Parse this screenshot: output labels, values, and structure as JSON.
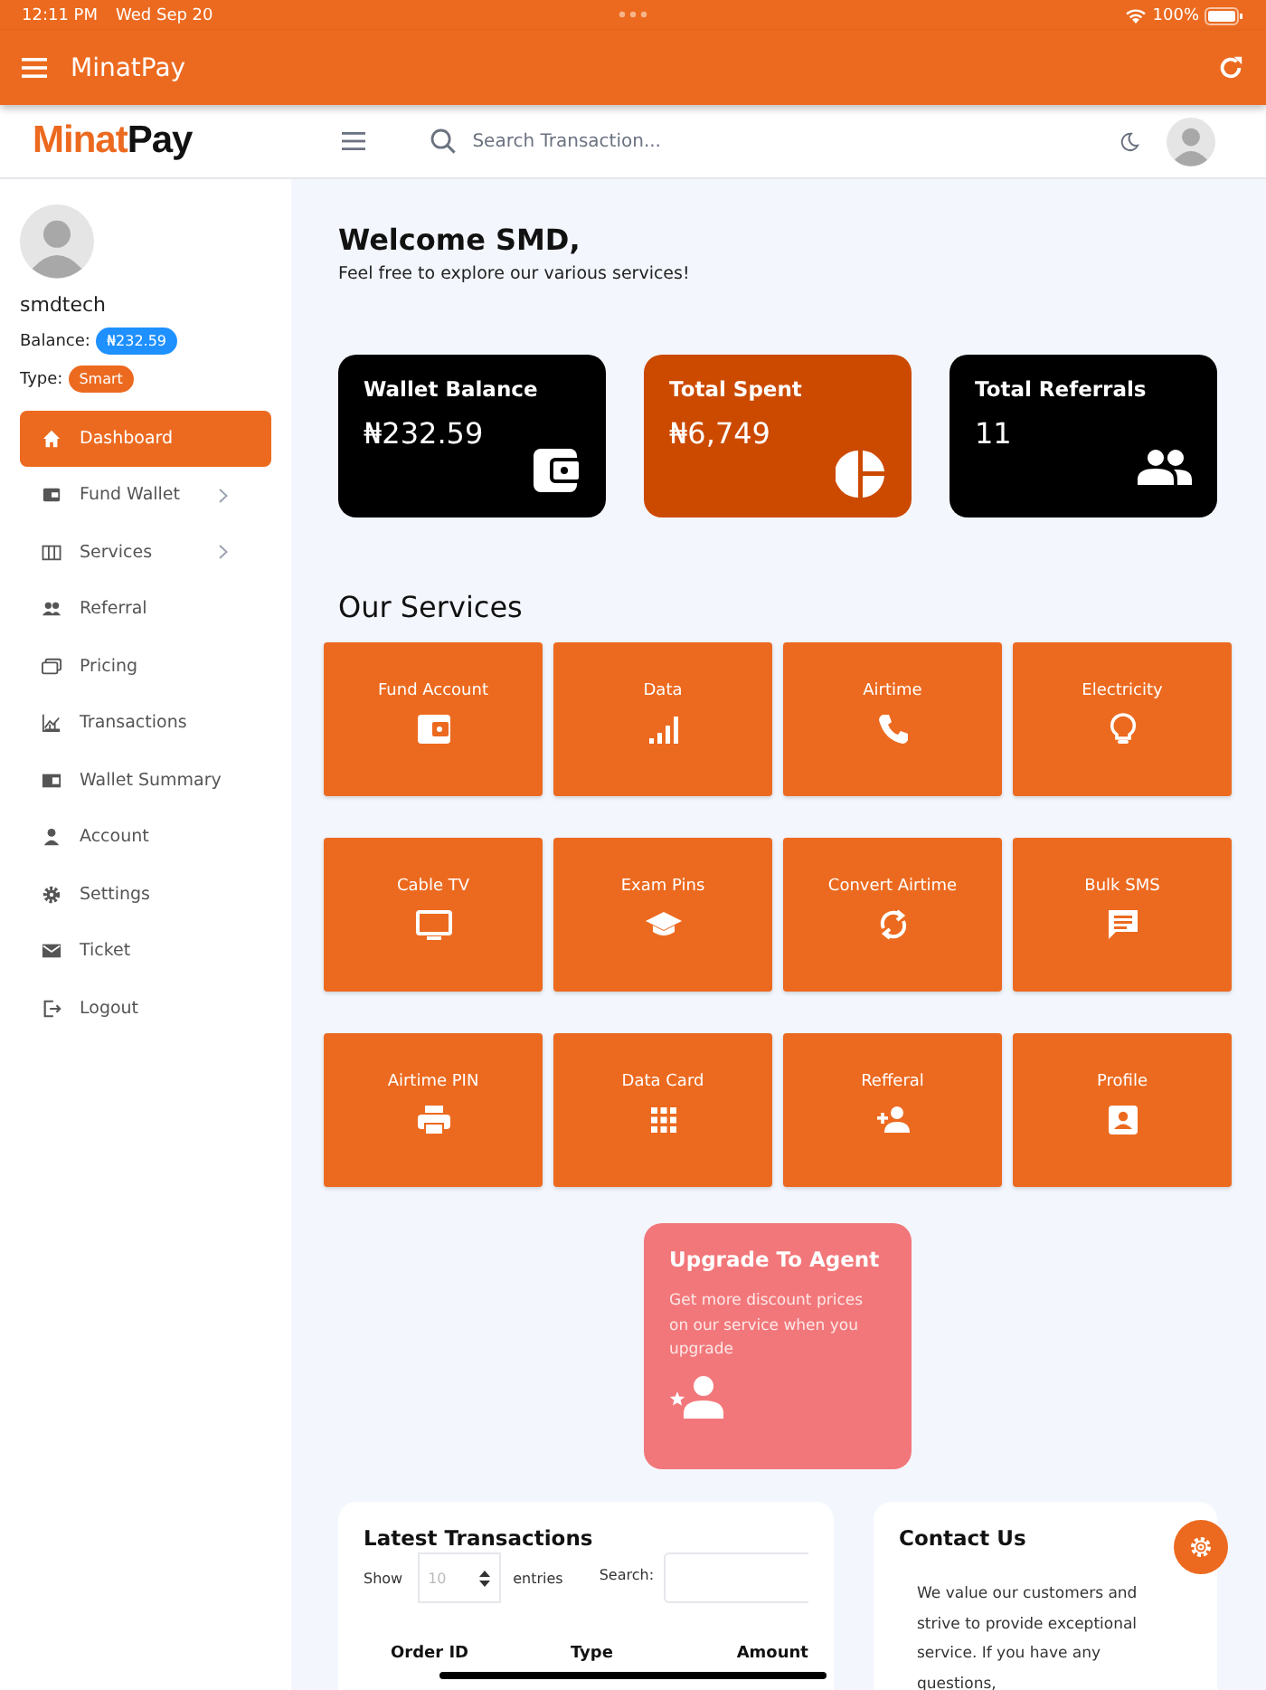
{
  "status_bar": {
    "time": "12:11 PM",
    "date": "Wed Sep 20",
    "battery": "100%"
  },
  "app_bar": {
    "title": "MinatPay"
  },
  "header": {
    "logo": {
      "accent": "Minat",
      "rest": "Pay"
    },
    "search": {
      "placeholder": "Search Transaction..."
    }
  },
  "profile": {
    "username": "smdtech",
    "balance_label": "Balance:",
    "balance": "₦232.59",
    "type_label": "Type:",
    "type": "Smart"
  },
  "sidebar": {
    "items": [
      {
        "label": "Dashboard",
        "selected": true,
        "expandable": false
      },
      {
        "label": "Fund Wallet",
        "selected": false,
        "expandable": true
      },
      {
        "label": "Services",
        "selected": false,
        "expandable": true
      },
      {
        "label": "Referral",
        "selected": false,
        "expandable": false
      },
      {
        "label": "Pricing",
        "selected": false,
        "expandable": false
      },
      {
        "label": "Transactions",
        "selected": false,
        "expandable": false
      },
      {
        "label": "Wallet Summary",
        "selected": false,
        "expandable": false
      },
      {
        "label": "Account",
        "selected": false,
        "expandable": false
      },
      {
        "label": "Settings",
        "selected": false,
        "expandable": false
      },
      {
        "label": "Ticket",
        "selected": false,
        "expandable": false
      },
      {
        "label": "Logout",
        "selected": false,
        "expandable": false
      }
    ]
  },
  "welcome": {
    "title": "Welcome SMD,",
    "subtitle": "Feel free to explore our various services!"
  },
  "stats": [
    {
      "label": "Wallet Balance",
      "value": "₦232.59",
      "color": "#000000"
    },
    {
      "label": "Total Spent",
      "value": "₦6,749",
      "color": "#cc4a00"
    },
    {
      "label": "Total Referrals",
      "value": "11",
      "color": "#000000"
    }
  ],
  "services": {
    "title": "Our Services",
    "items": [
      {
        "label": "Fund Account"
      },
      {
        "label": "Data"
      },
      {
        "label": "Airtime"
      },
      {
        "label": "Electricity"
      },
      {
        "label": "Cable TV"
      },
      {
        "label": "Exam Pins"
      },
      {
        "label": "Convert Airtime"
      },
      {
        "label": "Bulk SMS"
      },
      {
        "label": "Airtime PIN"
      },
      {
        "label": "Data Card"
      },
      {
        "label": "Refferal"
      },
      {
        "label": "Profile"
      }
    ]
  },
  "upgrade": {
    "title": "Upgrade To Agent",
    "text": "Get more discount prices on our service when you upgrade"
  },
  "latest_transactions": {
    "title": "Latest Transactions",
    "show_label": "Show",
    "entries_value": "10",
    "entries_label": "entries",
    "search_label": "Search:",
    "columns": [
      "Order ID",
      "Type",
      "Amount"
    ]
  },
  "contact": {
    "title": "Contact Us",
    "text": "We value our customers and strive to provide exceptional service. If you have any questions,"
  }
}
